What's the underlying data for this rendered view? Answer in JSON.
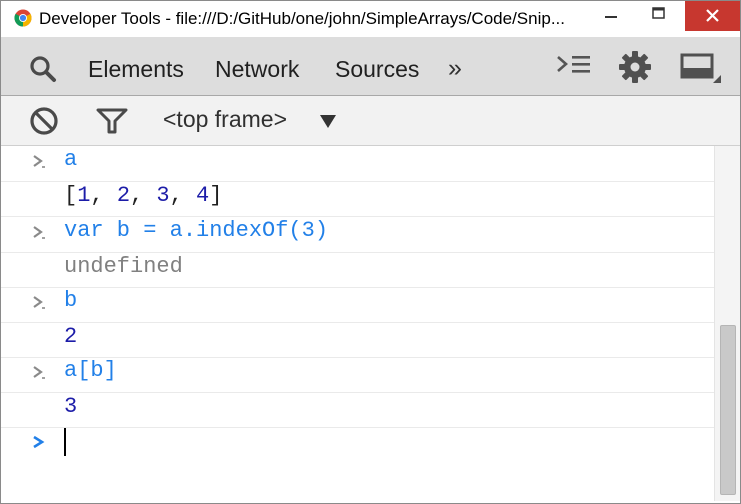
{
  "window": {
    "title": "Developer Tools - file:///D:/GitHub/one/john/SimpleArrays/Code/Snip..."
  },
  "toolbar": {
    "tabs": [
      {
        "label": "Elements"
      },
      {
        "label": "Network"
      },
      {
        "label": "Sources"
      }
    ],
    "more_label": "»"
  },
  "subbar": {
    "frame_label": "<top frame>"
  },
  "console": {
    "entries": [
      {
        "input": "a",
        "output": "[1, 2, 3, 4]"
      },
      {
        "input": "var b = a.indexOf(3)",
        "output": "undefined"
      },
      {
        "input": "b",
        "output": "2"
      },
      {
        "input": "a[b]",
        "output": "3"
      }
    ]
  },
  "colors": {
    "close_button": "#c7372f",
    "input_text": "#2280e8",
    "number_output": "#1c1ca8",
    "undefined_output": "#808080",
    "active_prompt": "#2280e8"
  }
}
